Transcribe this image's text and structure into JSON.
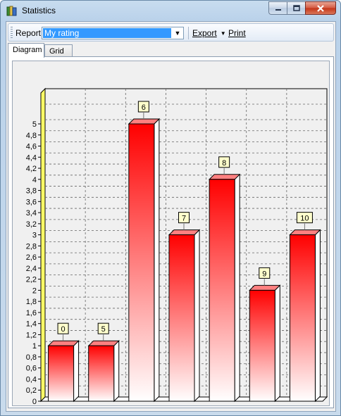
{
  "window": {
    "title": "Statistics",
    "icon": "books-icon",
    "caption_buttons": {
      "minimize": "minimize-icon",
      "maximize": "maximize-icon",
      "close": "close-icon"
    }
  },
  "toolbar": {
    "report_label": "Report",
    "report_value": "My rating",
    "export_label": "Export",
    "print_label": "Print"
  },
  "tabs": [
    {
      "label": "Diagram",
      "active": true
    },
    {
      "label": "Grid",
      "active": false
    }
  ],
  "colors": {
    "bar_top": "#ff0000",
    "bar_bottom": "#ffffff",
    "left_wall": "#ffff66",
    "label_bg": "#ffffcc"
  },
  "chart_data": {
    "type": "bar",
    "categories": [
      "0",
      "5",
      "6",
      "7",
      "8",
      "9",
      "10"
    ],
    "values": [
      1,
      1,
      5,
      3,
      4,
      2,
      3
    ],
    "data_labels": [
      "0",
      "5",
      "6",
      "7",
      "8",
      "9",
      "10"
    ],
    "ylim": [
      0,
      5
    ],
    "y_ticks": [
      "0",
      "0,2",
      "0,4",
      "0,6",
      "0,8",
      "1",
      "1,2",
      "1,4",
      "1,6",
      "1,8",
      "2",
      "2,2",
      "2,4",
      "2,6",
      "2,8",
      "3",
      "3,2",
      "3,4",
      "3,6",
      "3,8",
      "4",
      "4,2",
      "4,4",
      "4,6",
      "4,8",
      "5"
    ],
    "grid": true,
    "style": "3d"
  }
}
